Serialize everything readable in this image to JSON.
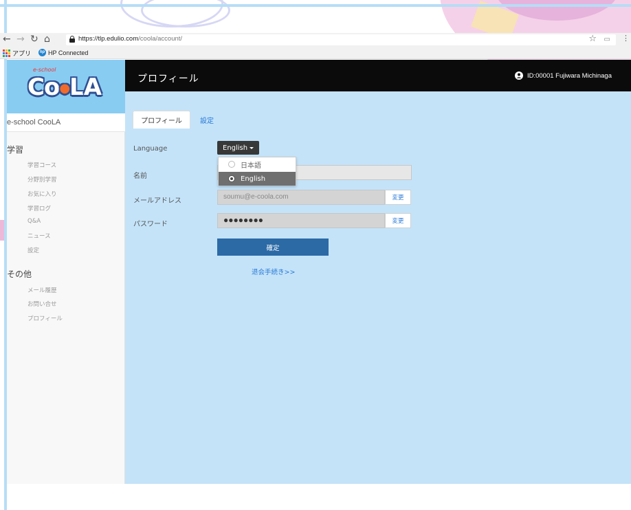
{
  "browser": {
    "url_host": "https://tlp.edulio.com",
    "url_path": "/coola/account/",
    "bookmarks": [
      {
        "label": "アプリ"
      },
      {
        "label": "HP Connected"
      }
    ],
    "icons": [
      "back-icon",
      "forward-icon",
      "reload-icon",
      "home-icon",
      "lock-icon",
      "star-icon",
      "apps-icon",
      "hp-icon"
    ]
  },
  "sidebar": {
    "logo_small": "e-school",
    "logo_text": [
      "C",
      "o",
      "●",
      "L",
      "A"
    ],
    "site_name": "e-school CooLA",
    "sections": [
      {
        "title": "学習",
        "items": [
          "学習コース",
          "分野別学習",
          "お気に入り",
          "学習ログ",
          "Q&A",
          "ニュース",
          "設定"
        ]
      },
      {
        "title": "その他",
        "items": [
          "メール履歴",
          "お問い合せ",
          "プロフィール"
        ]
      }
    ]
  },
  "header": {
    "title": "プロフィール",
    "user": "ID:00001 Fujiwara Michinaga"
  },
  "tabs": [
    {
      "label": "プロフィール",
      "active": true
    },
    {
      "label": "設定",
      "active": false
    }
  ],
  "form": {
    "language_label": "Language",
    "language_value": "English",
    "language_options": [
      {
        "label": "日本語",
        "selected": false
      },
      {
        "label": "English",
        "selected": true
      }
    ],
    "name_label": "名前",
    "name_value": "",
    "email_label": "メールアドレス",
    "email_value": "soumu@e-coola.com",
    "email_change": "変更",
    "password_label": "パスワード",
    "password_value": "●●●●●●●●",
    "password_change": "変更",
    "submit_label": "確定",
    "withdraw_link": "退会手続き>>"
  },
  "colors": {
    "header_bg": "#0b0b0b",
    "main_bg": "#c4e3f9",
    "logo_bg": "#89ccf1",
    "submit_bg": "#2c6aa6",
    "link": "#2a7ad6"
  }
}
